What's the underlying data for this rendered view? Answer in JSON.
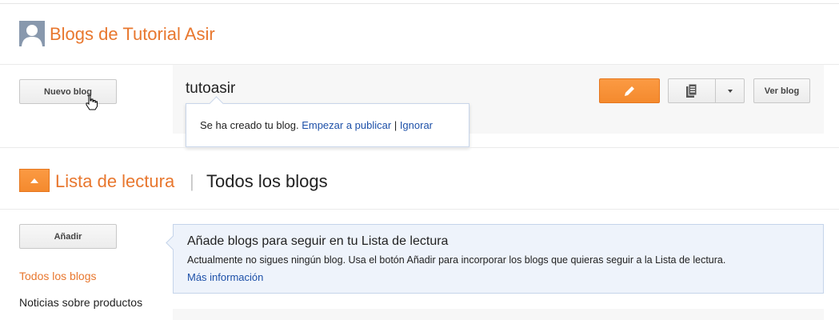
{
  "header": {
    "site_title": "Blogs de Tutorial Asir"
  },
  "sidebar": {
    "new_blog_label": "Nuevo blog",
    "add_label": "Añadir",
    "nav": [
      {
        "label": "Todos los blogs",
        "active": true
      },
      {
        "label": "Noticias sobre productos",
        "active": false
      }
    ]
  },
  "blog": {
    "name": "tutoasir",
    "view_blog_label": "Ver blog",
    "edit_icon": "pencil-icon",
    "pages_icon": "pages-icon",
    "dropdown_icon": "caret-down-icon"
  },
  "tooltip": {
    "text": "Se ha creado tu blog. ",
    "start_link": "Empezar a publicar",
    "separator": " | ",
    "ignore_link": "Ignorar"
  },
  "reading_list": {
    "title": "Lista de lectura",
    "separator": "|",
    "subtitle": "Todos los blogs",
    "collapse_icon": "caret-up-icon"
  },
  "info": {
    "title": "Añade blogs para seguir en tu Lista de lectura",
    "text": "Actualmente no sigues ningún blog. Usa el botón Añadir para incorporar los blogs que quieras seguir a la Lista de lectura.",
    "more_link": "Más información"
  },
  "colors": {
    "accent": "#e8772e",
    "link": "#1d50a8",
    "info_bg": "#eef3fb"
  }
}
